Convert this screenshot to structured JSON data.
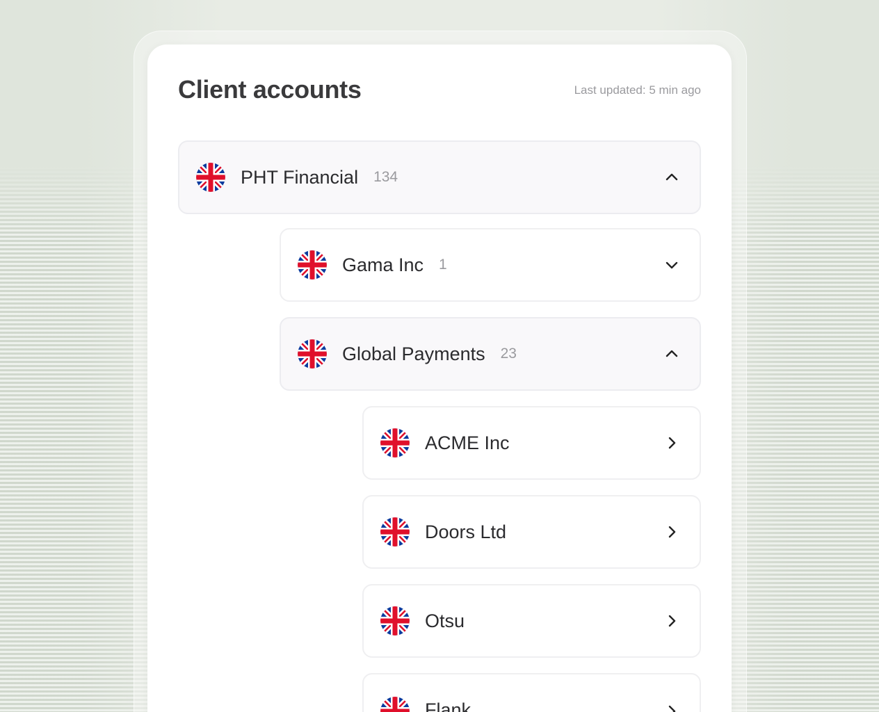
{
  "header": {
    "title": "Client accounts",
    "last_updated": "Last updated: 5 min ago"
  },
  "accounts": [
    {
      "name": "PHT Financial",
      "count": "134",
      "state": "expanded",
      "chevron": "chevron-up-icon",
      "flag": "uk-flag-icon"
    },
    {
      "name": "Gama Inc",
      "count": "1",
      "state": "collapsed",
      "chevron": "chevron-down-icon",
      "flag": "uk-flag-icon"
    },
    {
      "name": "Global Payments",
      "count": "23",
      "state": "expanded",
      "chevron": "chevron-up-icon",
      "flag": "uk-flag-icon"
    },
    {
      "name": "ACME Inc",
      "count": "",
      "state": "leaf",
      "chevron": "chevron-right-icon",
      "flag": "uk-flag-icon"
    },
    {
      "name": "Doors Ltd",
      "count": "",
      "state": "leaf",
      "chevron": "chevron-right-icon",
      "flag": "uk-flag-icon"
    },
    {
      "name": "Otsu",
      "count": "",
      "state": "leaf",
      "chevron": "chevron-right-icon",
      "flag": "uk-flag-icon"
    },
    {
      "name": "Flank",
      "count": "",
      "state": "leaf",
      "chevron": "chevron-right-icon",
      "flag": "uk-flag-icon"
    }
  ],
  "colors": {
    "background": "#dfe5dc",
    "card": "#ffffff",
    "expanded_row": "#f9f8fa",
    "title": "#3a3a3c",
    "muted": "#9a9a9e",
    "flag_blue": "#0b3b9e",
    "flag_red": "#e0102b"
  }
}
